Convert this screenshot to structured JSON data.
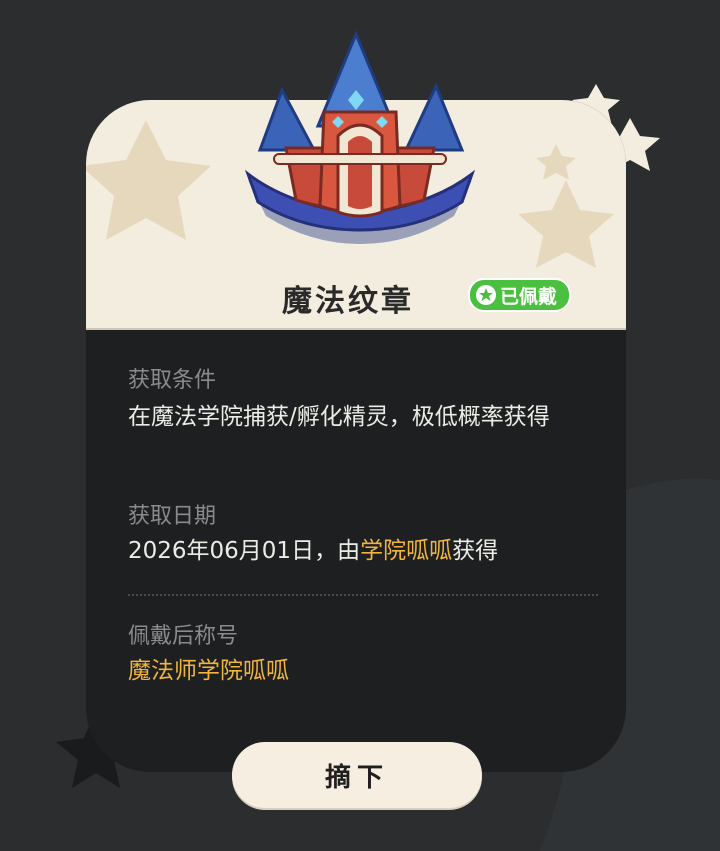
{
  "badge": {
    "name": "魔法纹章",
    "status": "已佩戴"
  },
  "acquire_condition": {
    "label": "获取条件",
    "text": "在魔法学院捕获/孵化精灵，极低概率获得"
  },
  "acquire_date": {
    "label": "获取日期",
    "prefix": "2026年06月01日，由",
    "player": "学院呱呱",
    "suffix": "获得"
  },
  "title_after_wear": {
    "label": "佩戴后称号",
    "value": "魔法师学院呱呱"
  },
  "action": {
    "remove_label": "摘下"
  },
  "colors": {
    "background": "#2b2d2f",
    "card_top": "#f3eddf",
    "card_body": "#1e1f21",
    "accent_gold": "#f0b541",
    "worn_green": "#4bbf3f",
    "button_bg": "#f5eee1"
  }
}
